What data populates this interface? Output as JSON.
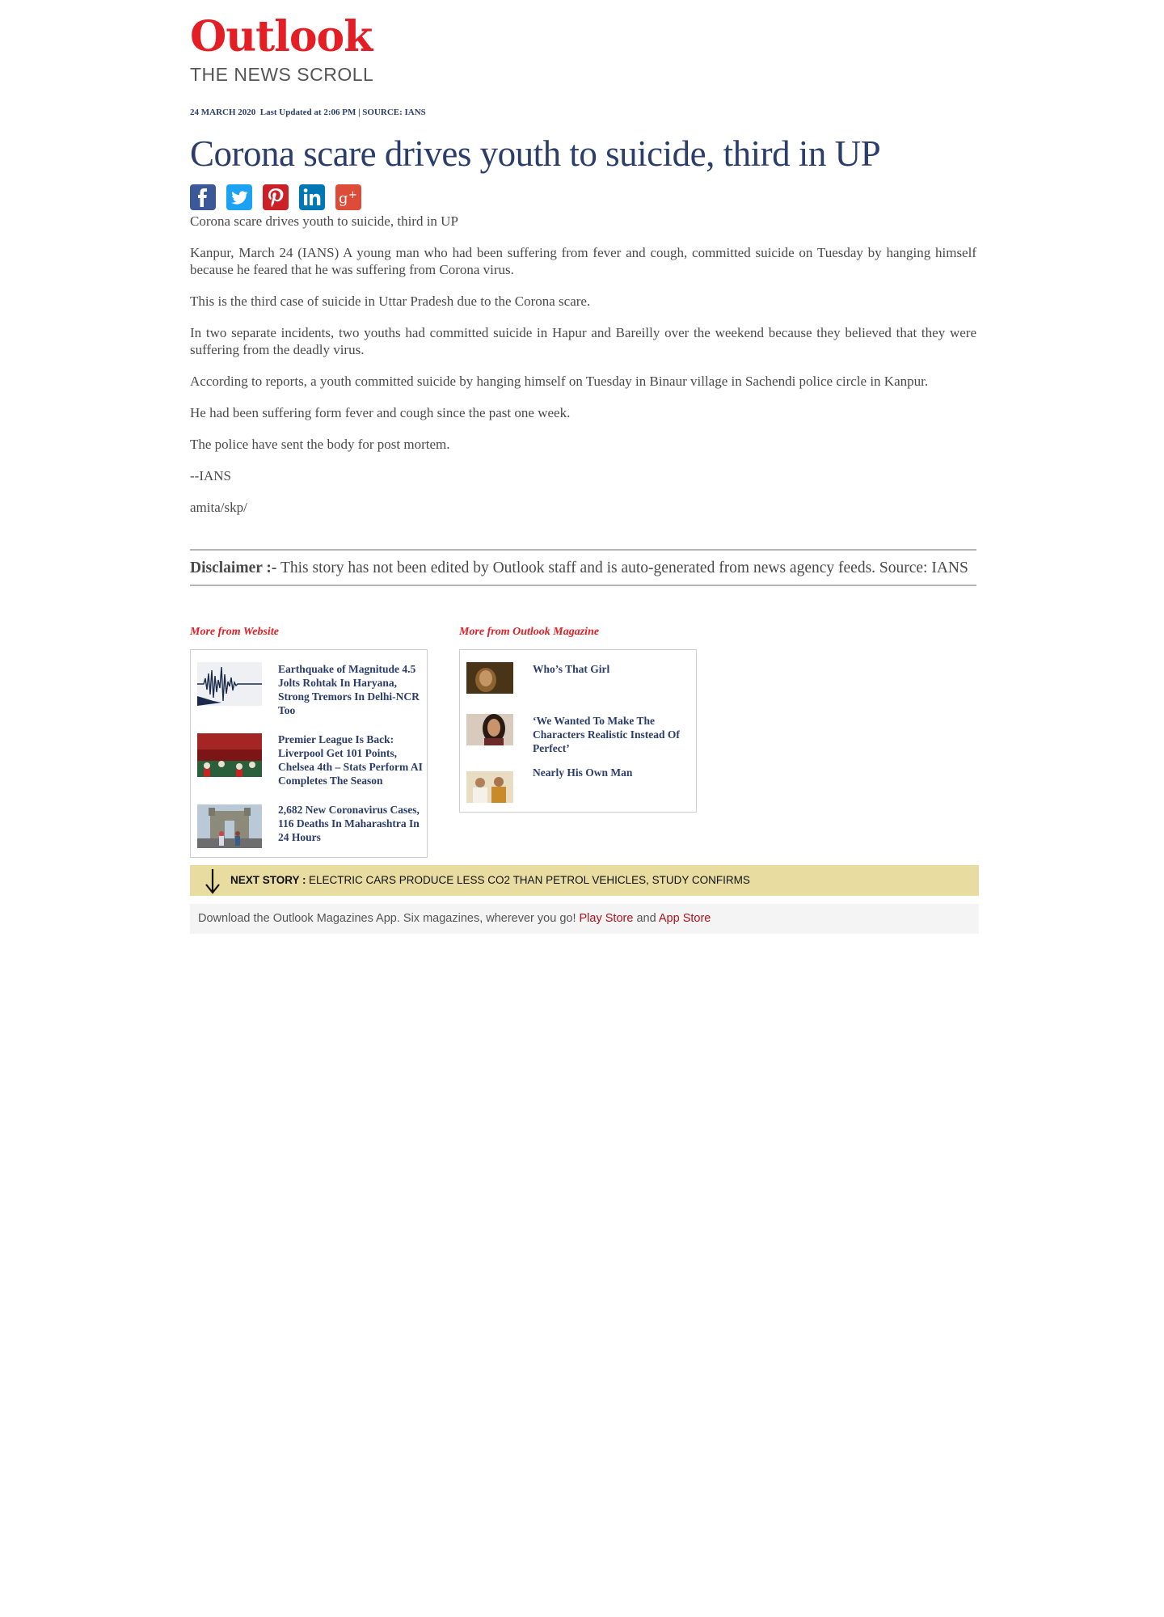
{
  "brand": {
    "logo_text": "Outlook",
    "section": "THE NEWS SCROLL",
    "logo_color": "#e31e24"
  },
  "meta": {
    "date": "24 MARCH 2020",
    "updated": "Last Updated at 2:06 PM | SOURCE: IANS"
  },
  "article": {
    "headline": "Corona scare drives youth to suicide, third in UP",
    "paragraphs": [
      "Corona scare drives youth to suicide, third in UP",
      "Kanpur, March 24 (IANS) A young man who had been suffering from fever and cough, committed suicide on Tuesday by hanging himself because he feared that he was suffering from Corona virus.",
      "This is the third case of suicide in Uttar Pradesh due to the Corona scare.",
      "In two separate incidents, two youths had committed suicide in Hapur and Bareilly over the weekend because they believed that they were suffering from the deadly virus.",
      "According to reports, a youth committed suicide by hanging himself on Tuesday in Binaur village in Sachendi police circle in Kanpur.",
      "He had been suffering form fever and cough since the past one week.",
      "The police have sent the body for post mortem.",
      "--IANS",
      "amita/skp/"
    ]
  },
  "share": {
    "icons": [
      "facebook-icon",
      "twitter-icon",
      "pinterest-icon",
      "linkedin-icon",
      "google-plus-icon"
    ],
    "colors": {
      "facebook": "#3b5998",
      "twitter": "#1da1f2",
      "pinterest": "#cb2027",
      "linkedin": "#0077b5",
      "google_plus": "#dd4b39"
    }
  },
  "disclaimer": {
    "label": "Disclaimer :-",
    "text": "This story has not been edited by Outlook staff and is auto-generated from news agency feeds. Source: IANS"
  },
  "more_website": {
    "title": "More from Website",
    "items": [
      {
        "title": "Earthquake of Magnitude 4.5 Jolts Rohtak In Haryana, Strong Tremors In Delhi-NCR Too",
        "thumb": "seismograph"
      },
      {
        "title": "Premier League Is Back: Liverpool Get 101 Points, Chelsea 4th – Stats Perform AI Completes The Season",
        "thumb": "football-crowd"
      },
      {
        "title": "2,682 New Coronavirus Cases, 116 Deaths In Maharashtra In 24 Hours",
        "thumb": "gateway-of-india"
      }
    ]
  },
  "more_magazine": {
    "title": "More from Outlook Magazine",
    "items": [
      {
        "title": "Who’s That Girl",
        "thumb": "film-still"
      },
      {
        "title": "‘We Wanted To Make The Characters Realistic Instead Of Perfect’",
        "thumb": "actress-portrait"
      },
      {
        "title": "Nearly His Own Man",
        "thumb": "politicians"
      }
    ]
  },
  "next_story": {
    "label": "NEXT STORY :",
    "title": "Electric cars produce less CO2 than petrol vehicles, study confirms"
  },
  "app_banner": {
    "text": "Download the Outlook Magazines App. Six magazines, wherever you go!",
    "play_store": "Play Store",
    "and": "and",
    "app_store": "App Store"
  }
}
